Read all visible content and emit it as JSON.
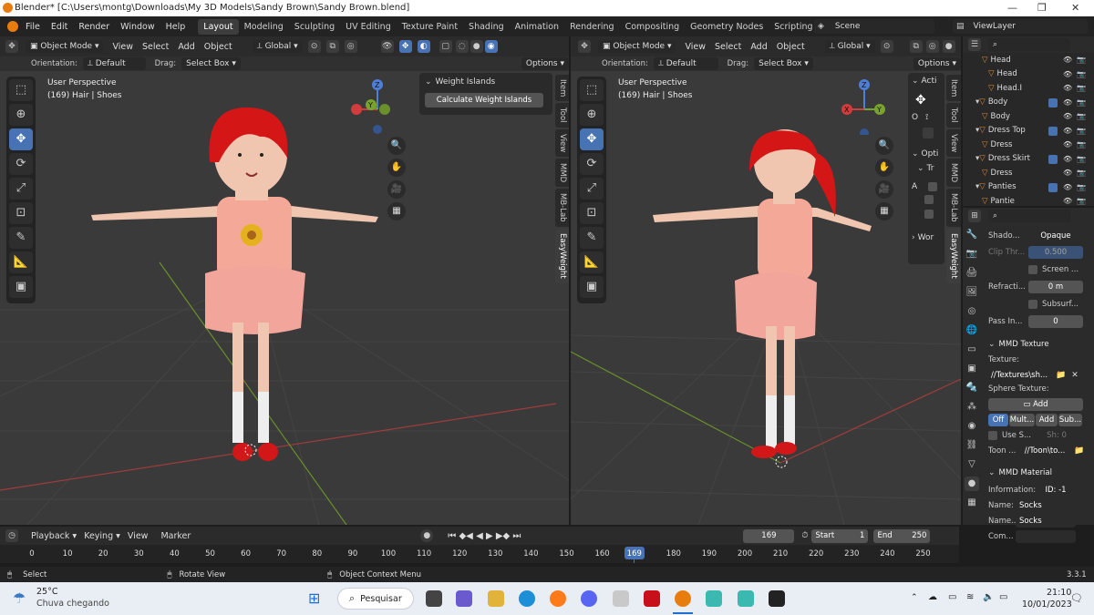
{
  "window": {
    "title": "Blender* [C:\\Users\\montg\\Downloads\\My 3D Models\\Sandy Brown\\Sandy Brown.blend]",
    "controls": [
      "—",
      "❐",
      "✕"
    ]
  },
  "menu": [
    "File",
    "Edit",
    "Render",
    "Window",
    "Help"
  ],
  "workspaces": [
    "Layout",
    "Modeling",
    "Sculpting",
    "UV Editing",
    "Texture Paint",
    "Shading",
    "Animation",
    "Rendering",
    "Compositing",
    "Geometry Nodes",
    "Scripting"
  ],
  "active_workspace": "Layout",
  "add_workspace": "+",
  "scene": {
    "label": "Scene",
    "view_layer": "ViewLayer"
  },
  "viewport_header": {
    "mode": "Object Mode",
    "menus": [
      "View",
      "Select",
      "Add",
      "Object"
    ],
    "orientation_value": "Global",
    "orientation_label": "Orientation:",
    "orientation_default": "Default",
    "drag_label": "Drag:",
    "drag_value": "Select Box",
    "options": "Options"
  },
  "viewport_left": {
    "perspective": "User Perspective",
    "object": "(169) Hair | Shoes",
    "panel_title": "Weight Islands",
    "panel_button": "Calculate Weight Islands",
    "tabs": [
      "Item",
      "Tool",
      "View",
      "MMD",
      "MB-Lab",
      "EasyWeight"
    ],
    "active_tab": "EasyWeight"
  },
  "viewport_right": {
    "perspective": "User Perspective",
    "object": "(169) Hair | Shoes",
    "panel_sections": [
      "Acti",
      "Opti",
      "Tr",
      "Wor"
    ],
    "panel_letters": [
      "O",
      "A"
    ],
    "tabs": [
      "Item",
      "Tool",
      "View",
      "MMD",
      "MB-Lab",
      "EasyWeight"
    ]
  },
  "gizmo": {
    "x": "X",
    "y": "Y",
    "z": "Z"
  },
  "outliner": {
    "rows": [
      {
        "label": "Head",
        "indent": 3,
        "type": "mesh"
      },
      {
        "label": "Head",
        "indent": 4,
        "type": "mesh"
      },
      {
        "label": "Head.I",
        "indent": 4,
        "type": "material"
      },
      {
        "label": "Body",
        "indent": 2,
        "type": "object"
      },
      {
        "label": "Body",
        "indent": 3,
        "type": "material"
      },
      {
        "label": "Dress Top",
        "indent": 2,
        "type": "object"
      },
      {
        "label": "Dress",
        "indent": 3,
        "type": "material"
      },
      {
        "label": "Dress Skirt",
        "indent": 2,
        "type": "object"
      },
      {
        "label": "Dress",
        "indent": 3,
        "type": "material"
      },
      {
        "label": "Panties",
        "indent": 2,
        "type": "object"
      },
      {
        "label": "Pantie",
        "indent": 3,
        "type": "material"
      }
    ]
  },
  "properties": {
    "shadow_label": "Shado...",
    "shadow_value": "Opaque",
    "clip_label": "Clip Thr...",
    "clip_value": "0.500",
    "screen_label": "Screen ...",
    "refraction_label": "Refracti...",
    "refraction_value": "0 m",
    "subsurf_label": "Subsurf...",
    "pass_label": "Pass In...",
    "pass_value": "0",
    "mmd_texture_title": "MMD Texture",
    "texture_label": "Texture:",
    "texture_value": "//Textures\\sh...",
    "sphere_label": "Sphere Texture:",
    "add_label": "Add",
    "sphere_modes": [
      "Off",
      "Mult...",
      "Add",
      "Sub..."
    ],
    "use_s_label": "Use S...",
    "sh_value": "Sh: 0",
    "toon_label": "Toon ...",
    "toon_value": "//Toon\\to...",
    "mmd_material_title": "MMD Material",
    "information_label": "Information:",
    "id_value": "ID: -1",
    "name_label": "Name:",
    "name_value": "Socks",
    "name_e_label": "Name...",
    "name_e_value": "Socks",
    "comment_label": "Com..."
  },
  "timeline": {
    "menus": [
      "Playback",
      "Keying",
      "View",
      "Marker"
    ],
    "current_frame": "169",
    "start_label": "Start",
    "start_value": "1",
    "end_label": "End",
    "end_value": "250",
    "ticks": [
      "0",
      "10",
      "20",
      "30",
      "40",
      "50",
      "60",
      "70",
      "80",
      "90",
      "100",
      "110",
      "120",
      "130",
      "140",
      "150",
      "160",
      "169",
      "180",
      "190",
      "200",
      "210",
      "220",
      "230",
      "240",
      "250"
    ]
  },
  "statusbar": {
    "select": "Select",
    "rotate": "Rotate View",
    "context": "Object Context Menu",
    "version": "3.3.1"
  },
  "taskbar": {
    "temperature": "25°C",
    "weather": "Chuva chegando",
    "search": "Pesquisar",
    "time": "21:10",
    "date": "10/01/2023"
  },
  "colors": {
    "accent": "#4772b3",
    "grid_red": "#b83c3c",
    "grid_green": "#6f9a2c",
    "outliner_icon": "#e48c3a"
  }
}
